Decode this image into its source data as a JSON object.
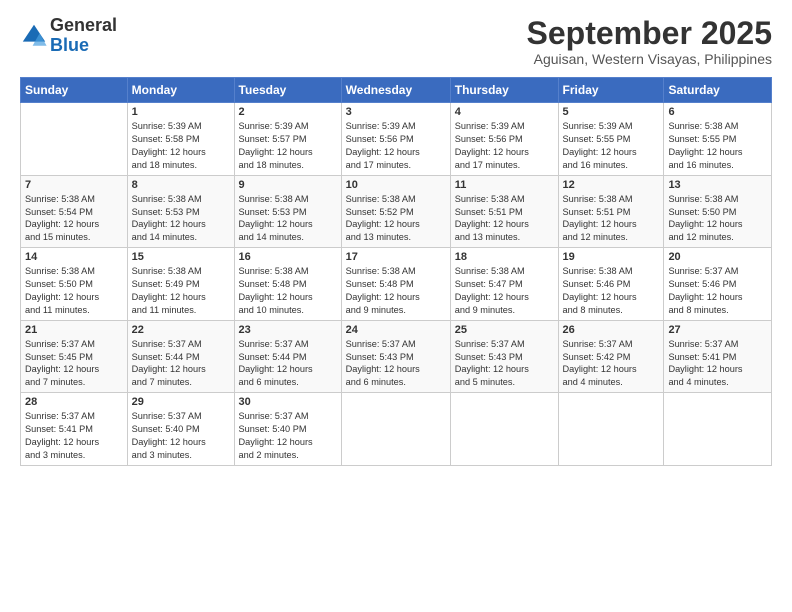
{
  "header": {
    "logo_general": "General",
    "logo_blue": "Blue",
    "month_title": "September 2025",
    "location": "Aguisan, Western Visayas, Philippines"
  },
  "weekdays": [
    "Sunday",
    "Monday",
    "Tuesday",
    "Wednesday",
    "Thursday",
    "Friday",
    "Saturday"
  ],
  "weeks": [
    [
      {
        "day": "",
        "info": ""
      },
      {
        "day": "1",
        "info": "Sunrise: 5:39 AM\nSunset: 5:58 PM\nDaylight: 12 hours\nand 18 minutes."
      },
      {
        "day": "2",
        "info": "Sunrise: 5:39 AM\nSunset: 5:57 PM\nDaylight: 12 hours\nand 18 minutes."
      },
      {
        "day": "3",
        "info": "Sunrise: 5:39 AM\nSunset: 5:56 PM\nDaylight: 12 hours\nand 17 minutes."
      },
      {
        "day": "4",
        "info": "Sunrise: 5:39 AM\nSunset: 5:56 PM\nDaylight: 12 hours\nand 17 minutes."
      },
      {
        "day": "5",
        "info": "Sunrise: 5:39 AM\nSunset: 5:55 PM\nDaylight: 12 hours\nand 16 minutes."
      },
      {
        "day": "6",
        "info": "Sunrise: 5:38 AM\nSunset: 5:55 PM\nDaylight: 12 hours\nand 16 minutes."
      }
    ],
    [
      {
        "day": "7",
        "info": "Sunrise: 5:38 AM\nSunset: 5:54 PM\nDaylight: 12 hours\nand 15 minutes."
      },
      {
        "day": "8",
        "info": "Sunrise: 5:38 AM\nSunset: 5:53 PM\nDaylight: 12 hours\nand 14 minutes."
      },
      {
        "day": "9",
        "info": "Sunrise: 5:38 AM\nSunset: 5:53 PM\nDaylight: 12 hours\nand 14 minutes."
      },
      {
        "day": "10",
        "info": "Sunrise: 5:38 AM\nSunset: 5:52 PM\nDaylight: 12 hours\nand 13 minutes."
      },
      {
        "day": "11",
        "info": "Sunrise: 5:38 AM\nSunset: 5:51 PM\nDaylight: 12 hours\nand 13 minutes."
      },
      {
        "day": "12",
        "info": "Sunrise: 5:38 AM\nSunset: 5:51 PM\nDaylight: 12 hours\nand 12 minutes."
      },
      {
        "day": "13",
        "info": "Sunrise: 5:38 AM\nSunset: 5:50 PM\nDaylight: 12 hours\nand 12 minutes."
      }
    ],
    [
      {
        "day": "14",
        "info": "Sunrise: 5:38 AM\nSunset: 5:50 PM\nDaylight: 12 hours\nand 11 minutes."
      },
      {
        "day": "15",
        "info": "Sunrise: 5:38 AM\nSunset: 5:49 PM\nDaylight: 12 hours\nand 11 minutes."
      },
      {
        "day": "16",
        "info": "Sunrise: 5:38 AM\nSunset: 5:48 PM\nDaylight: 12 hours\nand 10 minutes."
      },
      {
        "day": "17",
        "info": "Sunrise: 5:38 AM\nSunset: 5:48 PM\nDaylight: 12 hours\nand 9 minutes."
      },
      {
        "day": "18",
        "info": "Sunrise: 5:38 AM\nSunset: 5:47 PM\nDaylight: 12 hours\nand 9 minutes."
      },
      {
        "day": "19",
        "info": "Sunrise: 5:38 AM\nSunset: 5:46 PM\nDaylight: 12 hours\nand 8 minutes."
      },
      {
        "day": "20",
        "info": "Sunrise: 5:37 AM\nSunset: 5:46 PM\nDaylight: 12 hours\nand 8 minutes."
      }
    ],
    [
      {
        "day": "21",
        "info": "Sunrise: 5:37 AM\nSunset: 5:45 PM\nDaylight: 12 hours\nand 7 minutes."
      },
      {
        "day": "22",
        "info": "Sunrise: 5:37 AM\nSunset: 5:44 PM\nDaylight: 12 hours\nand 7 minutes."
      },
      {
        "day": "23",
        "info": "Sunrise: 5:37 AM\nSunset: 5:44 PM\nDaylight: 12 hours\nand 6 minutes."
      },
      {
        "day": "24",
        "info": "Sunrise: 5:37 AM\nSunset: 5:43 PM\nDaylight: 12 hours\nand 6 minutes."
      },
      {
        "day": "25",
        "info": "Sunrise: 5:37 AM\nSunset: 5:43 PM\nDaylight: 12 hours\nand 5 minutes."
      },
      {
        "day": "26",
        "info": "Sunrise: 5:37 AM\nSunset: 5:42 PM\nDaylight: 12 hours\nand 4 minutes."
      },
      {
        "day": "27",
        "info": "Sunrise: 5:37 AM\nSunset: 5:41 PM\nDaylight: 12 hours\nand 4 minutes."
      }
    ],
    [
      {
        "day": "28",
        "info": "Sunrise: 5:37 AM\nSunset: 5:41 PM\nDaylight: 12 hours\nand 3 minutes."
      },
      {
        "day": "29",
        "info": "Sunrise: 5:37 AM\nSunset: 5:40 PM\nDaylight: 12 hours\nand 3 minutes."
      },
      {
        "day": "30",
        "info": "Sunrise: 5:37 AM\nSunset: 5:40 PM\nDaylight: 12 hours\nand 2 minutes."
      },
      {
        "day": "",
        "info": ""
      },
      {
        "day": "",
        "info": ""
      },
      {
        "day": "",
        "info": ""
      },
      {
        "day": "",
        "info": ""
      }
    ]
  ]
}
